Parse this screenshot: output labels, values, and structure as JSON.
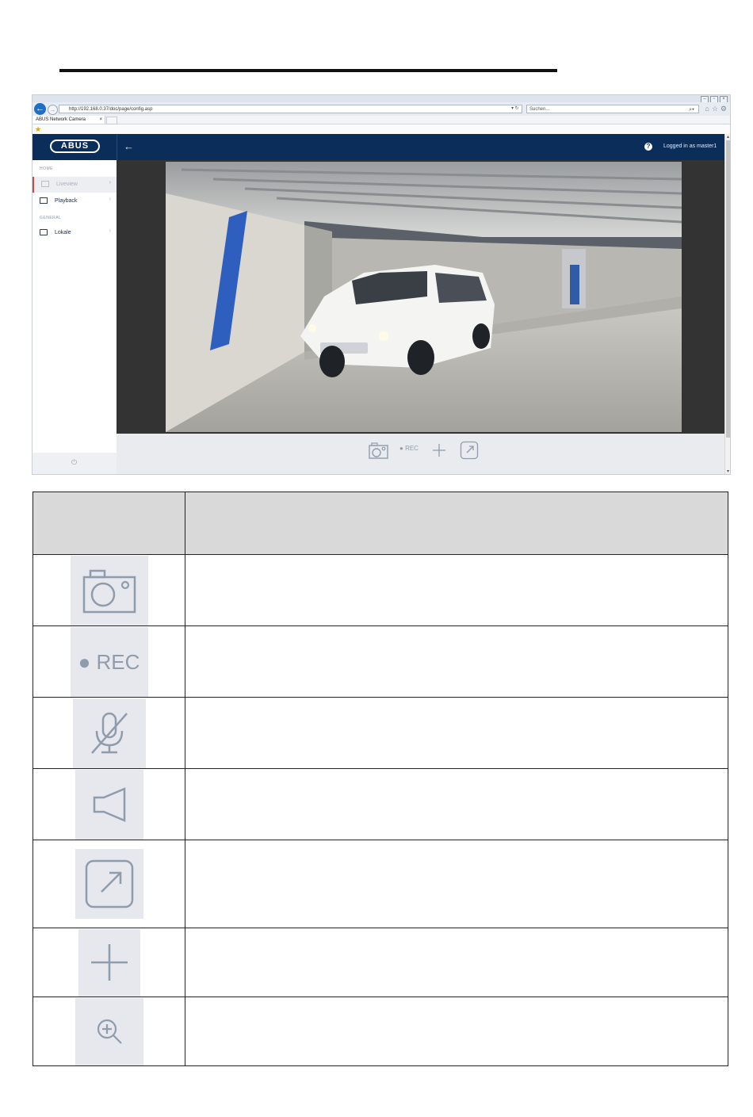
{
  "browser": {
    "address": "http://192.168.0.37/doc/page/config.asp",
    "search_placeholder": "Suchen...",
    "tab_title": "ABUS Network Camera",
    "tab_close": "×"
  },
  "app": {
    "brand": "ABUS",
    "back_arrow": "←",
    "help": "?",
    "logged_in": "Logged in as master1"
  },
  "sidebar": {
    "section_home": "HOME",
    "section_general": "GENERAL",
    "items": [
      {
        "label": "Liveview",
        "active": true
      },
      {
        "label": "Playback",
        "active": false
      },
      {
        "label": "Lokale",
        "active": false
      }
    ],
    "chevron": "›",
    "power": "⏻"
  },
  "controls": {
    "rec_label": "REC"
  },
  "legend_table": {
    "header": [
      "",
      ""
    ],
    "rows": [
      {
        "icon": "camera-icon",
        "text": ""
      },
      {
        "icon": "rec-icon",
        "text": "",
        "icon_text": "REC"
      },
      {
        "icon": "microphone-muted-icon",
        "text": ""
      },
      {
        "icon": "speaker-icon",
        "text": ""
      },
      {
        "icon": "fullscreen-icon",
        "text": ""
      },
      {
        "icon": "plus-icon",
        "text": ""
      },
      {
        "icon": "zoom-in-icon",
        "text": ""
      }
    ]
  },
  "colors": {
    "header_navy": "#0b2d5a",
    "video_frame": "#333333",
    "icon_gray": "#8f9cad",
    "active_marker": "#c64b4b"
  }
}
